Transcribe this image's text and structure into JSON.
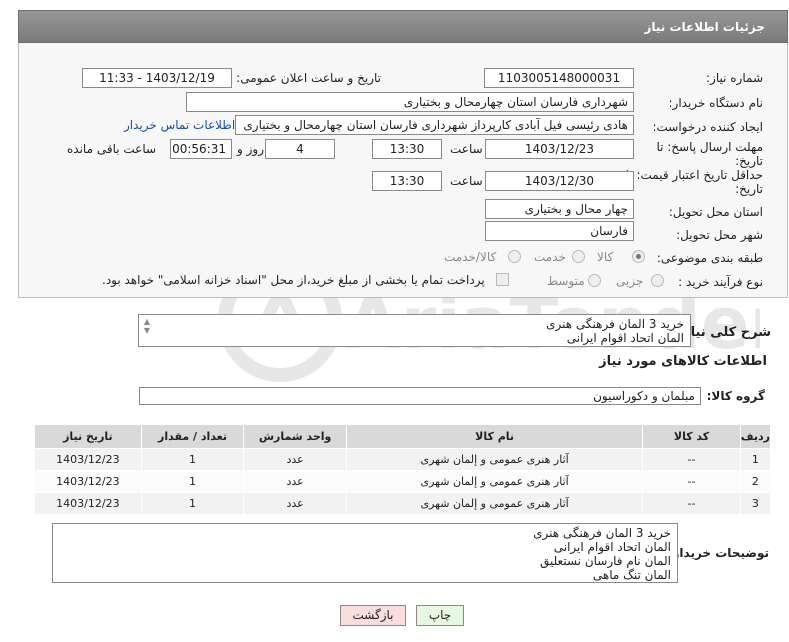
{
  "panel": {
    "title": "جزئیات اطلاعات نیاز"
  },
  "fields": {
    "need_number_label": "شماره نیاز:",
    "need_number": "1103005148000031",
    "announce_label": "تاریخ و ساعت اعلان عمومی:",
    "announce_value": "1403/12/19 - 11:33",
    "buyer_org_label": "نام دستگاه خریدار:",
    "buyer_org": "شهرداری فارسان استان چهارمحال و بختیاری",
    "requester_label": "ایجاد کننده درخواست:",
    "requester": "هادی رئیسی فیل آبادی کارپرداز شهرداری فارسان استان چهارمحال و بختیاری",
    "contact_link": "اطلاعات تماس خریدار",
    "reply_deadline_label_1": "مهلت ارسال پاسخ: تا",
    "reply_deadline_label_2": "تاریخ:",
    "reply_date": "1403/12/23",
    "time_label": "ساعت",
    "reply_time": "13:30",
    "days_value": "4",
    "days_label": "روز و",
    "remaining_time": "00:56:31",
    "remaining_label": "ساعت باقی مانده",
    "validity_label_1": "حداقل تاریخ اعتبار قیمت: تا",
    "validity_label_2": "تاریخ:",
    "validity_date": "1403/12/30",
    "validity_time": "13:30",
    "province_label": "استان محل تحویل:",
    "province": "چهار محال و بختیاری",
    "city_label": "شهر محل تحویل:",
    "city": "فارسان",
    "category_label": "طبقه بندی موضوعی:",
    "category_options": [
      "کالا",
      "خدمت",
      "کالا/خدمت"
    ],
    "process_label": "نوع فرآیند خرید :",
    "process_options": [
      "جزیی",
      "متوسط"
    ],
    "payment_note": "پرداخت تمام یا بخشی از مبلغ خرید،از محل \"اسناد خزانه اسلامی\" خواهد بود."
  },
  "summary": {
    "label": "شرح کلی نیاز:",
    "lines": [
      "خرید 3 المان فرهنگی هنری",
      "المان اتحاد اقوام ایرانی"
    ]
  },
  "goods": {
    "section_title": "اطلاعات کالاهای مورد نیاز",
    "group_label": "گروه کالا:",
    "group_value": "مبلمان و دکوراسیون",
    "columns": [
      "ردیف",
      "کد کالا",
      "نام کالا",
      "واحد شمارش",
      "تعداد / مقدار",
      "تاریخ نیاز"
    ],
    "rows": [
      [
        "1",
        "--",
        "آثار هنری عمومی و إلمان شهری",
        "عدد",
        "1",
        "1403/12/23"
      ],
      [
        "2",
        "--",
        "آثار هنری عمومی و إلمان شهری",
        "عدد",
        "1",
        "1403/12/23"
      ],
      [
        "3",
        "--",
        "آثار هنری عمومی و إلمان شهری",
        "عدد",
        "1",
        "1403/12/23"
      ]
    ]
  },
  "buyer_notes": {
    "label": "توضیحات خریدار:",
    "lines": [
      "خرید 3 المان فرهنگی هنری",
      "المان اتحاد اقوام ایرانی",
      "المان نام فارسان نستعلیق",
      "المان تنگ ماهی"
    ]
  },
  "buttons": {
    "print": "چاپ",
    "back": "بازگشت"
  },
  "watermark": {
    "text": "AriaTender.neT"
  }
}
